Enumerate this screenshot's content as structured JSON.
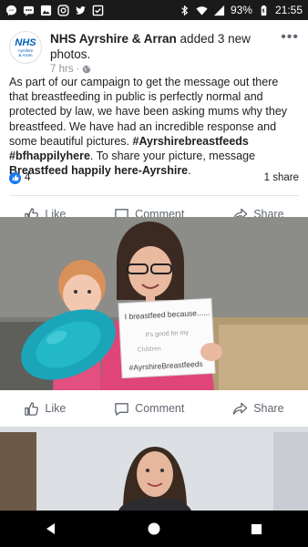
{
  "status_bar": {
    "battery": "93%",
    "time": "21:55",
    "icons": [
      "messenger-icon",
      "chat-icon",
      "image-icon",
      "instagram-icon",
      "twitter-icon",
      "checkbox-icon",
      "bluetooth-icon",
      "wifi-icon",
      "signal-icon",
      "battery-icon"
    ]
  },
  "post": {
    "page_name": "NHS Ayrshire & Arran",
    "action": " added 3 new photos.",
    "time": "7 hrs",
    "avatar": {
      "logo": "NHS",
      "line1": "Ayrshire",
      "line2": "& Arran"
    },
    "text_plain1": "As part of our campaign to get the message out there that breastfeeding in public is perfectly normal and protected by law, we have been asking mums why they breastfeed. We have had an incredible response and some beautiful pictures. ",
    "hashtags": "#Ayrshirebreastfeeds #bfhappilyhere",
    "text_plain2": ". To share your picture, message ",
    "text_bold_end": "Breastfeed happily here-Ayrshire",
    "text_end": ".",
    "reaction_count": "4",
    "shares": "1 share",
    "actions": {
      "like": "Like",
      "comment": "Comment",
      "share": "Share"
    }
  },
  "photo1": {
    "sign_line1": "I breastfeed because......",
    "sign_line2": "it's good for my",
    "sign_line3": "Children",
    "sign_hashtag": "#AyrshireBreastfeeds"
  },
  "actions2": {
    "like": "Like",
    "comment": "Comment",
    "share": "Share"
  },
  "colors": {
    "accent": "#1877f2",
    "nhs_blue": "#005eb8",
    "status_bar": "#1a1a1a"
  }
}
